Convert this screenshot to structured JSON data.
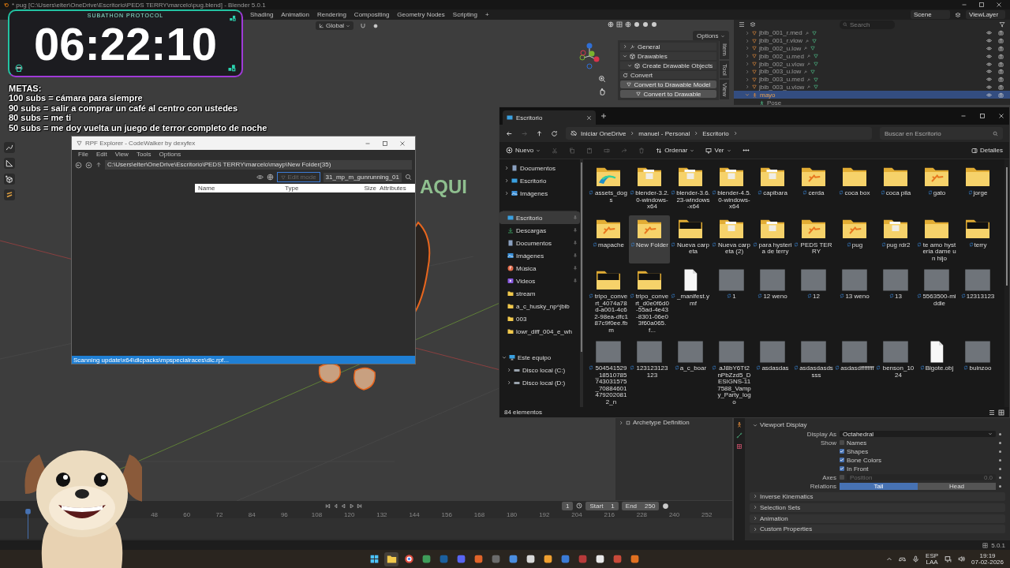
{
  "blender": {
    "title": "* pug [C:\\Users\\elter\\OneDrive\\Escritorio\\PEDS TERRY\\marcelo\\pug.blend] - Blender 5.0.1",
    "workspace_tabs": [
      "Shading",
      "Animation",
      "Rendering",
      "Compositing",
      "Geometry Nodes",
      "Scripting",
      "+"
    ],
    "scene": "Scene",
    "view_layer": "ViewLayer",
    "orientation": "Global",
    "options": "Options",
    "viewport_text": "AQUI",
    "sidebar_tabs": [
      "Item",
      "Tool",
      "View"
    ],
    "sidebar_sections": [
      {
        "label": "General",
        "expanded": false
      },
      {
        "label": "Drawables",
        "expanded": true,
        "children": [
          {
            "label": "Create Drawable Objects",
            "expanded": true
          }
        ]
      }
    ],
    "convert_label": "Convert",
    "convert_buttons": [
      "Convert to Drawable Model",
      "Convert to Drawable"
    ],
    "outliner": {
      "search_placeholder": "Search",
      "rows": [
        {
          "name": "jbib_001_r.med",
          "kind": "mesh",
          "selected": false,
          "expanded": false
        },
        {
          "name": "jbib_001_r.vlow",
          "kind": "mesh",
          "selected": false,
          "expanded": false
        },
        {
          "name": "jbib_002_u.low",
          "kind": "mesh",
          "selected": false,
          "expanded": false
        },
        {
          "name": "jbib_002_u.med",
          "kind": "mesh",
          "selected": false,
          "expanded": false
        },
        {
          "name": "jbib_002_u.vlow",
          "kind": "mesh",
          "selected": false,
          "expanded": false
        },
        {
          "name": "jbib_003_u.low",
          "kind": "mesh",
          "selected": false,
          "expanded": false
        },
        {
          "name": "jbib_003_u.med",
          "kind": "mesh",
          "selected": false,
          "expanded": false
        },
        {
          "name": "jbib_003_u.vlow",
          "kind": "mesh",
          "selected": false,
          "expanded": false
        },
        {
          "name": "mayo",
          "kind": "armature",
          "selected": true,
          "expanded": true,
          "children": [
            {
              "name": "Pose",
              "kind": "pose",
              "selected": false
            }
          ]
        }
      ]
    },
    "archetype_section": "Archetype Definition",
    "properties": {
      "section": "Viewport Display",
      "section_expanded": true,
      "display_as_label": "Display As",
      "display_as": "Octahedral",
      "show_label": "Show",
      "show_options": [
        {
          "label": "Names",
          "checked": false
        },
        {
          "label": "Shapes",
          "checked": true
        },
        {
          "label": "Bone Colors",
          "checked": true
        },
        {
          "label": "In Front",
          "checked": true
        }
      ],
      "axes_label": "Axes",
      "axes_checked": false,
      "position_label": "Position",
      "position_value": "0.0",
      "relations_label": "Relations",
      "relations": [
        {
          "label": "Tail",
          "selected": true
        },
        {
          "label": "Head",
          "selected": false
        }
      ],
      "collapsed_sections": [
        "Inverse Kinematics",
        "Selection Sets",
        "Animation",
        "Custom Properties"
      ]
    },
    "timeline": {
      "current_frame": "1",
      "start_label": "Start",
      "start": "1",
      "end_label": "End",
      "end": "250",
      "ticks": [
        "48",
        "60",
        "72",
        "84",
        "96",
        "108",
        "120",
        "132",
        "144",
        "156",
        "168",
        "180",
        "192",
        "204",
        "216",
        "228",
        "240",
        "252"
      ]
    },
    "version": "5.0.1"
  },
  "overlay": {
    "timer_caption": "SUBATHON PROTOCOL",
    "timer": "06:22:10",
    "goals_title": "METAS:",
    "goals": [
      "100 subs = cámara para siempre",
      "90 subs = salir a comprar un café al centro con ustedes",
      "80 subs = me ti",
      "50 subs = me doy vuelta un juego de terror completo de noche"
    ]
  },
  "rpf_explorer": {
    "title": "RPF Explorer - CodeWalker by dexyfex",
    "menu": [
      "File",
      "Edit",
      "View",
      "Tools",
      "Options"
    ],
    "path": "C:\\Users\\elter\\OneDrive\\Escritorio\\PEDS TERRY\\marcelo\\mayp\\New Folder(35)",
    "edit_mode": {
      "label": "Edit mode",
      "disabled": true
    },
    "search": "31_mp_m_gunrunning_01",
    "columns": [
      "Name",
      "Type",
      "Size",
      "Attributes"
    ],
    "status": "Scanning update\\x64\\dlcpacks\\mpspecialraces\\dlc.rpf..."
  },
  "explorer": {
    "tab": "Escritorio",
    "breadcrumb": [
      "Iniciar OneDrive",
      "manuel - Personal",
      "Escritorio"
    ],
    "search_placeholder": "Buscar en Escritorio",
    "toolbar": {
      "new": "Nuevo",
      "sort": "Ordenar",
      "view": "Ver",
      "details": "Detalles"
    },
    "nav_top": [
      {
        "label": "Documentos",
        "kind": "documents",
        "expanded": false
      },
      {
        "label": "Escritorio",
        "kind": "desktop",
        "expanded": false
      },
      {
        "label": "Imágenes",
        "kind": "pictures",
        "expanded": false
      }
    ],
    "quick_access": [
      {
        "label": "Escritorio",
        "kind": "desktop",
        "pinned": true,
        "selected": true
      },
      {
        "label": "Descargas",
        "kind": "downloads",
        "pinned": true,
        "selected": false
      },
      {
        "label": "Documentos",
        "kind": "documents",
        "pinned": true,
        "selected": false
      },
      {
        "label": "Imágenes",
        "kind": "pictures",
        "pinned": true,
        "selected": false
      },
      {
        "label": "Música",
        "kind": "music",
        "pinned": true,
        "selected": false
      },
      {
        "label": "Videos",
        "kind": "videos",
        "pinned": true,
        "selected": false
      },
      {
        "label": "stream",
        "kind": "folder",
        "pinned": false,
        "selected": false
      },
      {
        "label": "a_c_husky_np^jbib",
        "kind": "folder",
        "pinned": false,
        "selected": false
      },
      {
        "label": "003",
        "kind": "folder",
        "pinned": false,
        "selected": false
      },
      {
        "label": "lowr_diff_004_e_wh",
        "kind": "folder",
        "pinned": false,
        "selected": false
      }
    ],
    "this_pc": {
      "label": "Este equipo",
      "kind": "pc",
      "expanded": true,
      "children": [
        {
          "label": "Disco local (C:)",
          "kind": "drive",
          "expanded": false
        },
        {
          "label": "Disco local (D:)",
          "kind": "drive",
          "expanded": false
        }
      ]
    },
    "items": [
      {
        "name": "assets_dogs",
        "kind": "folder-swirl",
        "selected": false
      },
      {
        "name": "blender-3.2.0-windows-x64",
        "kind": "folder-file",
        "selected": false
      },
      {
        "name": "blender-3.6.23-windows-x64",
        "kind": "folder-file",
        "selected": false
      },
      {
        "name": "blender-4.5.0-windows-x64",
        "kind": "folder-file",
        "selected": false
      },
      {
        "name": "capibara",
        "kind": "folder-file",
        "selected": false
      },
      {
        "name": "cerda",
        "kind": "folder-logo",
        "selected": false
      },
      {
        "name": "coca box",
        "kind": "folder",
        "selected": false
      },
      {
        "name": "coca pila",
        "kind": "folder",
        "selected": false
      },
      {
        "name": "gato",
        "kind": "folder-logo",
        "selected": false
      },
      {
        "name": "jorge",
        "kind": "folder",
        "selected": false
      },
      {
        "name": "mapache",
        "kind": "folder-logo",
        "selected": false
      },
      {
        "name": "New Folder",
        "kind": "folder-logo",
        "selected": true
      },
      {
        "name": "Nueva carpeta",
        "kind": "folder-image",
        "selected": false
      },
      {
        "name": "Nueva carpeta (2)",
        "kind": "folder-file",
        "selected": false
      },
      {
        "name": "para hysteria de terry",
        "kind": "folder-file",
        "selected": false
      },
      {
        "name": "PEDS TERRY",
        "kind": "folder-logo",
        "selected": false
      },
      {
        "name": "pug",
        "kind": "folder-logo",
        "selected": false
      },
      {
        "name": "pug rdr2",
        "kind": "folder-file",
        "selected": false
      },
      {
        "name": "te amo hysteria dame un hijo",
        "kind": "folder",
        "selected": false
      },
      {
        "name": "terry",
        "kind": "folder-image",
        "selected": false
      },
      {
        "name": "tripo_convert_4074a78d-a001-4c62-98ea-dfc187c9f0ee.fbm",
        "kind": "folder-image",
        "selected": false
      },
      {
        "name": "tripo_convert_d0e0f6d0-55ad-4e43-8301-06e03f60a065.f...",
        "kind": "folder-image",
        "selected": false
      },
      {
        "name": "_manifest.ymf",
        "kind": "file",
        "selected": false
      },
      {
        "name": "1",
        "kind": "image",
        "selected": false
      },
      {
        "name": "12 weno",
        "kind": "image",
        "selected": false
      },
      {
        "name": "12",
        "kind": "image",
        "selected": false
      },
      {
        "name": "13 weno",
        "kind": "image",
        "selected": false
      },
      {
        "name": "13",
        "kind": "image",
        "selected": false
      },
      {
        "name": "5563500-middle",
        "kind": "image",
        "selected": false
      },
      {
        "name": "12313123",
        "kind": "image",
        "selected": false
      },
      {
        "name": "504541529_18510785743031575_708846014792020812_n",
        "kind": "image",
        "selected": false
      },
      {
        "name": "123123123123",
        "kind": "image",
        "selected": false
      },
      {
        "name": "a_c_boar",
        "kind": "image",
        "selected": false
      },
      {
        "name": "aJ8bY6Tt2nPbZzd5_DESIGNS-117588_Vampy_Party_logo",
        "kind": "image",
        "selected": false
      },
      {
        "name": "asdasdas",
        "kind": "image",
        "selected": false
      },
      {
        "name": "asdasdasdssss",
        "kind": "image",
        "selected": false
      },
      {
        "name": "asdasdffffffff",
        "kind": "image",
        "selected": false
      },
      {
        "name": "benson_1024",
        "kind": "image",
        "selected": false
      },
      {
        "name": "Bigote.obj",
        "kind": "file",
        "selected": false
      },
      {
        "name": "buinzoo",
        "kind": "image",
        "selected": false
      }
    ],
    "status": "84 elementos"
  },
  "taskbar": {
    "apps": [
      {
        "kind": "start",
        "selected": false
      },
      {
        "kind": "folder",
        "selected": true
      },
      {
        "kind": "browser",
        "selected": false
      },
      {
        "kind": "app",
        "color": "#3f9d5a",
        "selected": false
      },
      {
        "kind": "app",
        "color": "#1b5f9e",
        "selected": false
      },
      {
        "kind": "app",
        "color": "#5865f2",
        "selected": false
      },
      {
        "kind": "app",
        "color": "#e0642a",
        "selected": false
      },
      {
        "kind": "app",
        "color": "#6b6b6b",
        "selected": false
      },
      {
        "kind": "app",
        "color": "#4a8de0",
        "selected": false
      },
      {
        "kind": "app",
        "color": "#d8d8d8",
        "selected": false
      },
      {
        "kind": "app",
        "color": "#f0a030",
        "selected": false
      },
      {
        "kind": "app",
        "color": "#3b7bd6",
        "selected": false
      },
      {
        "kind": "app",
        "color": "#b83a3a",
        "selected": false
      },
      {
        "kind": "app",
        "color": "#e8e8e8",
        "selected": false
      },
      {
        "kind": "app",
        "color": "#c94a3a",
        "selected": false
      },
      {
        "kind": "app",
        "color": "#e07020",
        "selected": false
      }
    ],
    "language": "ESP",
    "layout": "LAA",
    "time": "19:19",
    "date": "07-02-2026"
  }
}
